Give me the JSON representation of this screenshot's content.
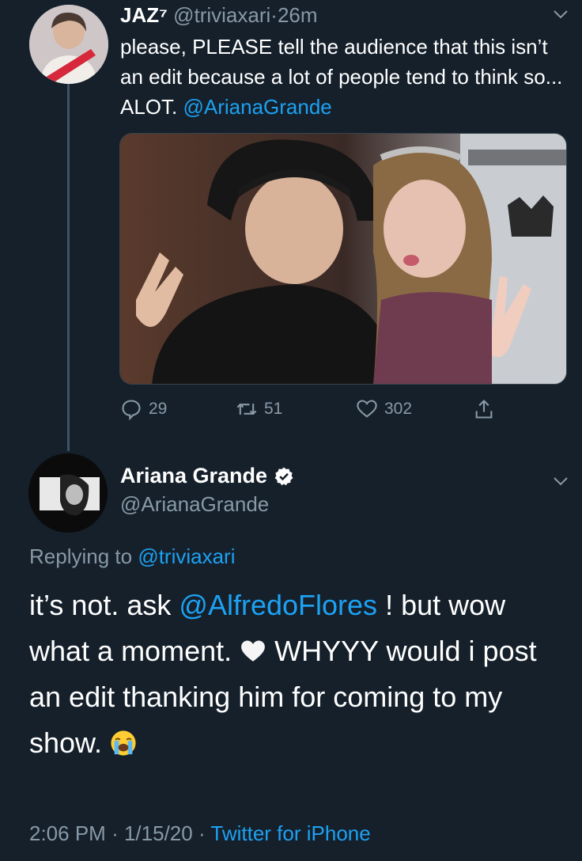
{
  "tweet1": {
    "name": "JAZ⁷",
    "handle": "@triviaxari",
    "separator": "·",
    "time": "26m",
    "text_part1": "please, PLEASE tell the audience that this isn’t an edit because a lot of people tend to think so... ALOT. ",
    "mention": "@ArianaGrande",
    "stats": {
      "replies": "29",
      "retweets": "51",
      "likes": "302"
    },
    "icons": {
      "reply": "reply-icon",
      "retweet": "retweet-icon",
      "like": "heart-icon",
      "share": "share-icon",
      "menu": "chevron-down-icon"
    }
  },
  "tweet2": {
    "name": "Ariana Grande",
    "handle": "@ArianaGrande",
    "replying_prefix": "Replying to ",
    "replying_handle": "@triviaxari",
    "text_a": "it’s not. ask ",
    "mention": "@AlfredoFlores",
    "text_b": " ! but wow what a moment. ",
    "text_c": " WHYYY would i post an edit thanking him for coming to my show. ",
    "emoji1": "white-heart-emoji",
    "emoji2": "loudly-crying-face-emoji",
    "time": "2:06 PM",
    "date": "1/15/20",
    "separator": "·",
    "source": "Twitter for iPhone",
    "verified_icon": "verified-badge-icon"
  },
  "colors": {
    "background": "#15202b",
    "text": "#ffffff",
    "secondary": "#8899a6",
    "accent": "#1da1f2",
    "thread_line": "#3d5466"
  }
}
